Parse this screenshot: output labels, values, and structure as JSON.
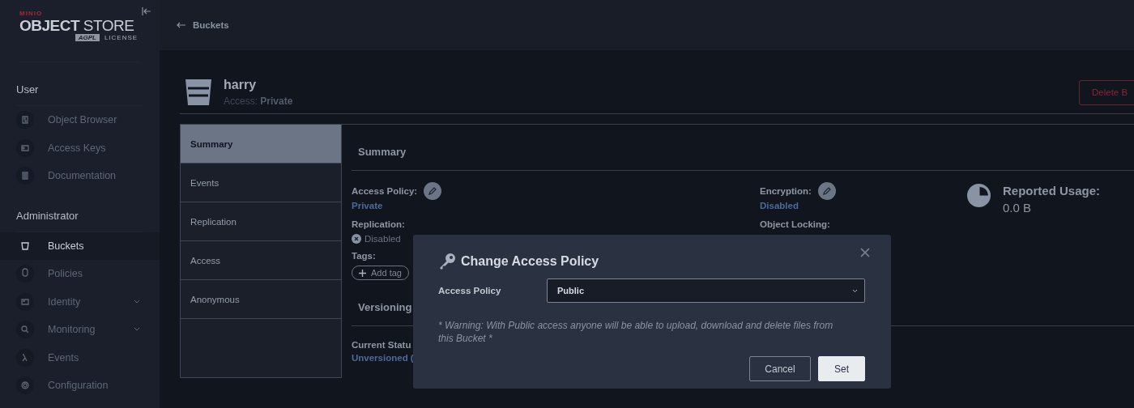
{
  "sidebar": {
    "logo": {
      "brand": "MINIO",
      "product_bold": "OBJECT",
      "product_light": "STORE",
      "badge": "AGPL",
      "license": "LICENSE"
    },
    "sections": [
      {
        "title": "User",
        "items": [
          {
            "label": "Object Browser",
            "selected": false,
            "expandable": false
          },
          {
            "label": "Access Keys",
            "selected": false,
            "expandable": false
          },
          {
            "label": "Documentation",
            "selected": false,
            "expandable": false
          }
        ]
      },
      {
        "title": "Administrator",
        "items": [
          {
            "label": "Buckets",
            "selected": true,
            "expandable": false
          },
          {
            "label": "Policies",
            "selected": false,
            "expandable": false
          },
          {
            "label": "Identity",
            "selected": false,
            "expandable": true
          },
          {
            "label": "Monitoring",
            "selected": false,
            "expandable": true
          },
          {
            "label": "Events",
            "selected": false,
            "expandable": false
          },
          {
            "label": "Configuration",
            "selected": false,
            "expandable": false
          }
        ]
      }
    ]
  },
  "topbar": {
    "back_link": "Buckets"
  },
  "bucket": {
    "name": "harry",
    "access": "Access: **Private**",
    "delete_button": "Delete B"
  },
  "tabs": [
    {
      "label": "Summary",
      "selected": true
    },
    {
      "label": "Events",
      "selected": false
    },
    {
      "label": "Replication",
      "selected": false
    },
    {
      "label": "Access",
      "selected": false
    },
    {
      "label": "Anonymous",
      "selected": false
    }
  ],
  "summary": {
    "title": "Summary",
    "access_policy": {
      "label": "Access Policy:",
      "value": "Private"
    },
    "replication": {
      "label": "Replication:",
      "value": "Disabled"
    },
    "tags": {
      "label": "Tags:",
      "add_button": "Add tag"
    },
    "encryption": {
      "label": "Encryption:",
      "value": "Disabled"
    },
    "object_locking": {
      "label": "Object Locking:"
    },
    "usage": {
      "label": "Reported Usage:",
      "value": "0.0 B"
    },
    "versioning": {
      "title": "Versioning",
      "status_label": "Current Statu",
      "status_value": "Unversioned ("
    }
  },
  "dialog": {
    "title": "Change Access Policy",
    "field_label": "Access Policy",
    "select_value": "Public",
    "warning": "* Warning: With Public access anyone will be able to upload, download and delete files from this Bucket *",
    "buttons": [
      {
        "label": "Cancel",
        "kind": "secondary"
      },
      {
        "label": "Set",
        "kind": "primary"
      }
    ]
  }
}
